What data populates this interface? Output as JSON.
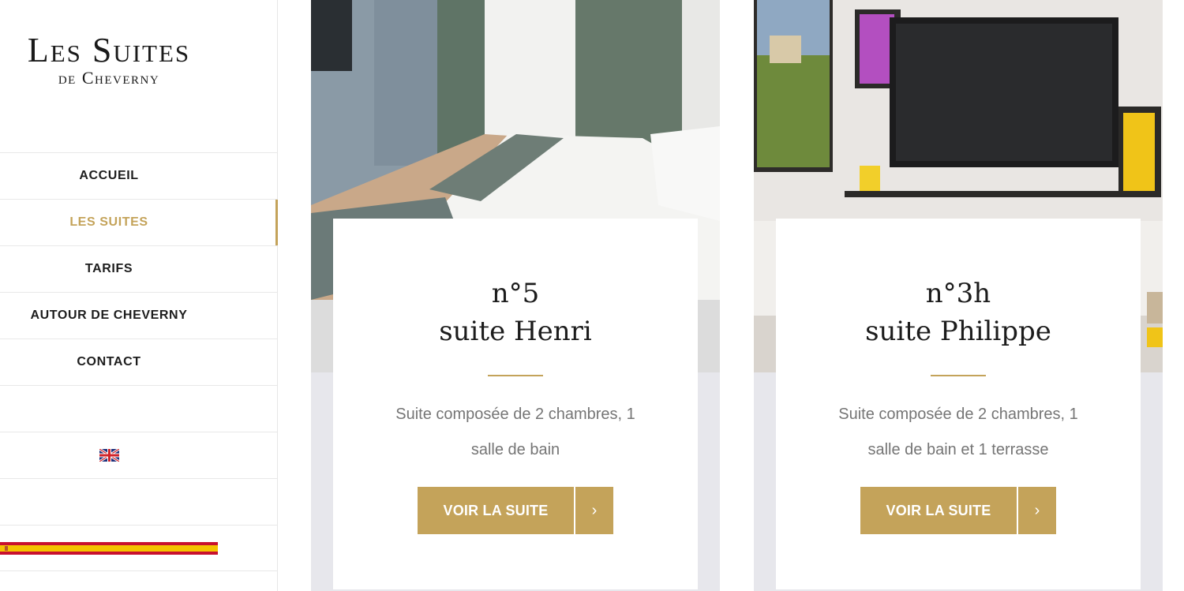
{
  "logo": {
    "line1": "Les Suites",
    "line2": "de Cheverny"
  },
  "nav": {
    "items": [
      {
        "label": "ACCUEIL"
      },
      {
        "label": "LES SUITES"
      },
      {
        "label": "TARIFS"
      },
      {
        "label": "AUTOUR DE CHEVERNY"
      },
      {
        "label": "CONTACT"
      }
    ]
  },
  "languages": [
    {
      "icon": "french-flag-icon"
    },
    {
      "icon": "uk-flag-icon"
    },
    {
      "icon": "german-flag-icon"
    },
    {
      "icon": "spanish-flag-icon"
    }
  ],
  "suites": [
    {
      "number": "n°5",
      "name": "suite Henri",
      "description": "Suite composée de 2 chambres, 1 salle de bain",
      "button_label": "VOIR LA SUITE",
      "arrow": "›"
    },
    {
      "number": "n°3h",
      "name": "suite Philippe",
      "description": "Suite composée de 2 chambres, 1 salle de bain et 1 terrasse",
      "button_label": "VOIR LA SUITE",
      "arrow": "›"
    }
  ],
  "colors": {
    "accent": "#c4a35a",
    "text_muted": "#757575",
    "panel": "#e7e7ec"
  }
}
